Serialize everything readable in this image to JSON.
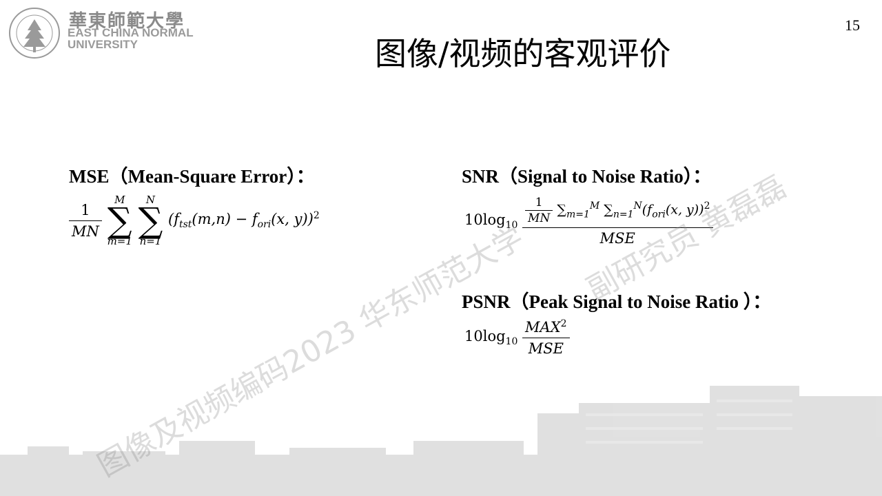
{
  "header": {
    "logo_cn": "華東師範大學",
    "logo_en_line1": "EAST CHINA NORMAL",
    "logo_en_line2": "UNIVERSITY",
    "page_number": "15"
  },
  "slide": {
    "title": "图像/视频的客观评价",
    "mse": {
      "heading": "MSE（Mean-Square Error）：",
      "frac_num": "1",
      "frac_den": "MN",
      "sum1_upper": "M",
      "sum1_lower": "m=1",
      "sum2_upper": "N",
      "sum2_lower": "n=1",
      "body_prefix": "(f",
      "sub_tst": "tst",
      "body_mid": "(m,n) − f",
      "sub_ori": "ori",
      "body_end": "(x, y))",
      "exp": "2"
    },
    "snr": {
      "heading": "SNR（Signal to Noise Ratio）：",
      "log_text": "10log",
      "log_base": "10",
      "inner_num": "1",
      "inner_den": "MN",
      "sum_m": "∑",
      "m_upper": "M",
      "m_lower": "m=1",
      "sum_n": "∑",
      "n_upper": "N",
      "n_lower": "n=1",
      "body_prefix": "(f",
      "sub_ori": "ori",
      "body_end": "(x, y))",
      "exp": "2",
      "denominator": "MSE"
    },
    "psnr": {
      "heading": "PSNR（Peak Signal to Noise Ratio ）：",
      "log_text": "10log",
      "log_base": "10",
      "num_text": "MAX",
      "num_exp": "2",
      "denominator": "MSE"
    }
  },
  "watermark": {
    "line1": "图像及视频编码2023 华东师范大学",
    "line2": "副研究员 黄磊磊"
  }
}
